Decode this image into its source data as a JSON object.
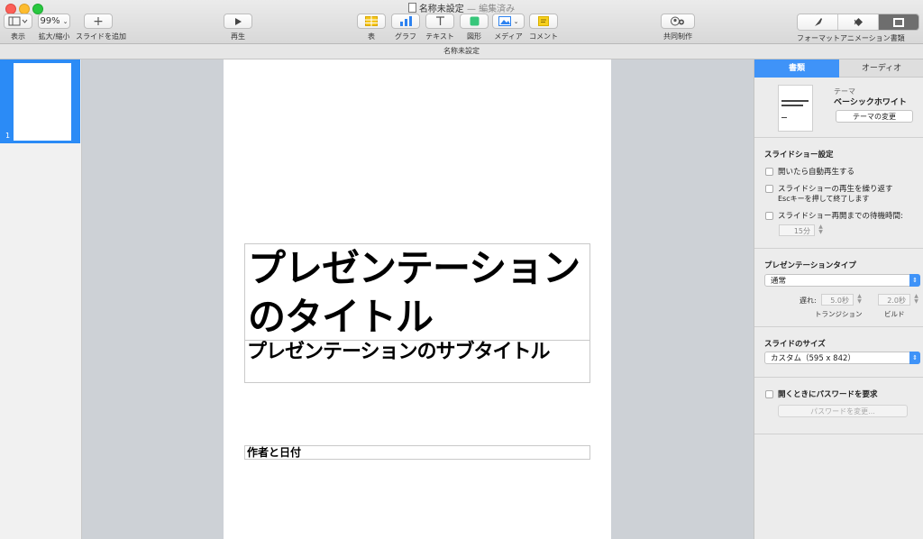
{
  "window": {
    "title": "名称未設定",
    "state": "— 編集済み"
  },
  "toolbar": {
    "view_label": "表示",
    "zoom_value": "99%",
    "zoom_label": "拡大/縮小",
    "add_slide_label": "スライドを追加",
    "play_label": "再生",
    "table_label": "表",
    "chart_label": "グラフ",
    "text_label": "テキスト",
    "shape_label": "図形",
    "media_label": "メディア",
    "comment_label": "コメント",
    "collaborate_label": "共同制作",
    "format_label": "フォーマット",
    "animate_label": "アニメーション",
    "document_label": "書類"
  },
  "doc_bar": {
    "title": "名称未設定"
  },
  "navigator": {
    "slides": [
      {
        "number": "1"
      }
    ]
  },
  "slide": {
    "title": "プレゼンテーションのタイトル",
    "subtitle": "プレゼンテーションのサブタイトル",
    "author": "作者と日付"
  },
  "inspector": {
    "tabs": {
      "document": "書類",
      "audio": "オーディオ"
    },
    "theme": {
      "label": "テーマ",
      "name": "ベーシックホワイト",
      "change_button": "テーマの変更"
    },
    "slideshow": {
      "title": "スライドショー設定",
      "autoplay": "開いたら自動再生する",
      "loop": "スライドショーの再生を繰り返す",
      "esc_note": "Escキーを押して終了します",
      "restart_idle": "スライドショー再開までの待機時間:",
      "idle_value": "15分"
    },
    "presentation_type": {
      "title": "プレゼンテーションタイプ",
      "value": "通常",
      "delay_label": "遅れ:",
      "transition_value": "5.0秒",
      "build_value": "2.0秒",
      "transition_label": "トランジション",
      "build_label": "ビルド"
    },
    "slide_size": {
      "title": "スライドのサイズ",
      "value": "カスタム（595 x 842）"
    },
    "password": {
      "require_label": "開くときにパスワードを要求",
      "change_button": "パスワードを変更..."
    }
  },
  "colors": {
    "accent": "#3f93f8",
    "selection": "#2b8bf6",
    "canvas_bg": "#cdd1d6"
  }
}
